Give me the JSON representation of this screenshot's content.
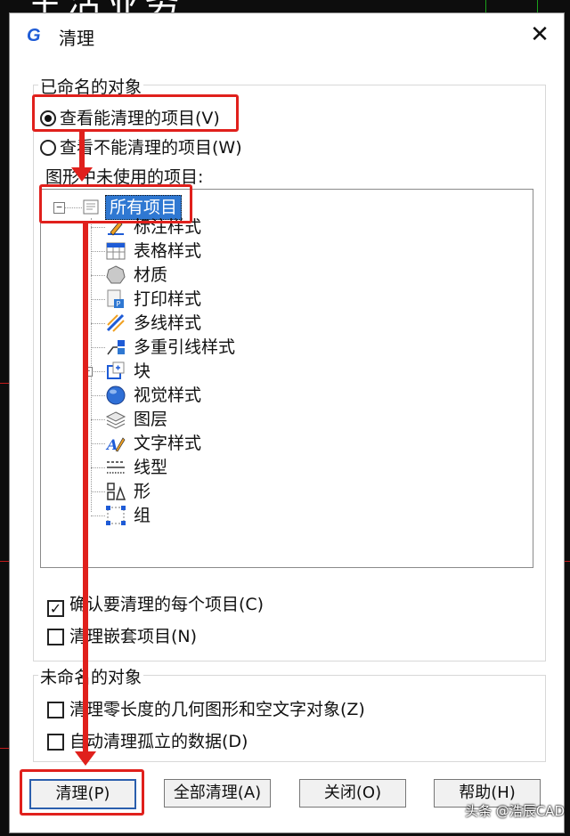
{
  "background": {
    "title_fragment": "生活业务"
  },
  "dialog": {
    "title": "清理",
    "app_icon_glyph": "G",
    "close_glyph": "✕"
  },
  "named_group": {
    "label": "已命名的对象",
    "radio_purgeable": {
      "label": "查看能清理的项目(V)",
      "checked": true
    },
    "radio_nonpurgeable": {
      "label": "查看不能清理的项目(W)",
      "checked": false
    },
    "tree_caption": "图形中未使用的项目:",
    "tree": {
      "root_label": "所有项目",
      "root_expander": "−",
      "items": [
        {
          "label": "标注样式",
          "icon": "dimension-style-icon"
        },
        {
          "label": "表格样式",
          "icon": "table-style-icon"
        },
        {
          "label": "材质",
          "icon": "material-icon"
        },
        {
          "label": "打印样式",
          "icon": "plot-style-icon"
        },
        {
          "label": "多线样式",
          "icon": "multiline-style-icon"
        },
        {
          "label": "多重引线样式",
          "icon": "multileader-style-icon"
        },
        {
          "label": "块",
          "icon": "block-icon",
          "expander": "+"
        },
        {
          "label": "视觉样式",
          "icon": "visual-style-icon"
        },
        {
          "label": "图层",
          "icon": "layer-icon"
        },
        {
          "label": "文字样式",
          "icon": "text-style-icon"
        },
        {
          "label": "线型",
          "icon": "linetype-icon"
        },
        {
          "label": "形",
          "icon": "shape-icon"
        },
        {
          "label": "组",
          "icon": "group-icon"
        }
      ]
    },
    "check_confirm": {
      "label": "确认要清理的每个项目(C)",
      "checked": true,
      "mark": "✓"
    },
    "check_nested": {
      "label": "清理嵌套项目(N)",
      "checked": false
    }
  },
  "unnamed_group": {
    "label": "未命名的对象",
    "check_zero_length": {
      "label": "清理零长度的几何图形和空文字对象(Z)",
      "checked": false
    },
    "check_orphan": {
      "label": "自动清理孤立的数据(D)",
      "checked": false
    }
  },
  "buttons": {
    "purge": "清理(P)",
    "purge_all": "全部清理(A)",
    "close": "关闭(O)",
    "help": "帮助(H)"
  },
  "watermark": "头条 @浩辰CAD",
  "colors": {
    "highlight_red": "#e0201c",
    "selection_blue": "#2f78d2",
    "icon_blue": "#1e5bd6"
  }
}
